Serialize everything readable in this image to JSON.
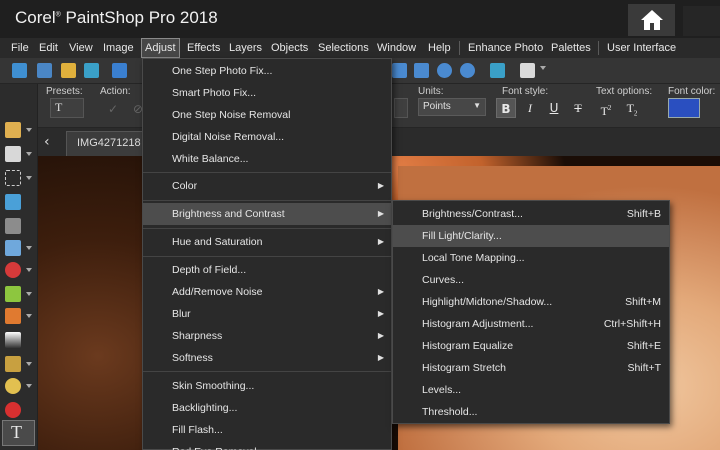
{
  "app": {
    "title": "Corel PaintShop Pro 2018",
    "title_main": "Corel",
    "title_rest": "PaintShop Pro 2018",
    "reg_mark": "®"
  },
  "menubar": [
    {
      "label": "File"
    },
    {
      "label": "Edit"
    },
    {
      "label": "View"
    },
    {
      "label": "Image"
    },
    {
      "label": "Adjust"
    },
    {
      "label": "Effects"
    },
    {
      "label": "Layers"
    },
    {
      "label": "Objects"
    },
    {
      "label": "Selections"
    },
    {
      "label": "Window"
    },
    {
      "label": "Help"
    },
    {
      "label": "Enhance Photo"
    },
    {
      "label": "Palettes"
    },
    {
      "label": "User Interface"
    }
  ],
  "options": {
    "presets_label": "Presets:",
    "action_label": "Action:",
    "units_label": "Units:",
    "units_value": "Points",
    "font_style_label": "Font style:",
    "text_options_label": "Text options:",
    "font_color_label": "Font color:",
    "font_color": "#2a4fc0"
  },
  "tab": {
    "label": "IMG4271218"
  },
  "adjust_menu": {
    "items": [
      {
        "label": "One Step Photo Fix..."
      },
      {
        "label": "Smart Photo Fix..."
      },
      {
        "label": "One Step Noise Removal"
      },
      {
        "label": "Digital Noise Removal..."
      },
      {
        "label": "White Balance..."
      },
      {
        "label": "Color"
      },
      {
        "label": "Brightness and Contrast"
      },
      {
        "label": "Hue and Saturation"
      },
      {
        "label": "Depth of Field..."
      },
      {
        "label": "Add/Remove Noise"
      },
      {
        "label": "Blur"
      },
      {
        "label": "Sharpness"
      },
      {
        "label": "Softness"
      },
      {
        "label": "Skin Smoothing..."
      },
      {
        "label": "Backlighting..."
      },
      {
        "label": "Fill Flash..."
      },
      {
        "label": "Red Eye Removal..."
      }
    ]
  },
  "brightness_menu": {
    "items": [
      {
        "label": "Brightness/Contrast...",
        "shortcut": "Shift+B"
      },
      {
        "label": "Fill Light/Clarity...",
        "shortcut": ""
      },
      {
        "label": "Local Tone Mapping...",
        "shortcut": ""
      },
      {
        "label": "Curves...",
        "shortcut": ""
      },
      {
        "label": "Highlight/Midtone/Shadow...",
        "shortcut": "Shift+M"
      },
      {
        "label": "Histogram Adjustment...",
        "shortcut": "Ctrl+Shift+H"
      },
      {
        "label": "Histogram Equalize",
        "shortcut": "Shift+E"
      },
      {
        "label": "Histogram Stretch",
        "shortcut": "Shift+T"
      },
      {
        "label": "Levels...",
        "shortcut": ""
      },
      {
        "label": "Threshold...",
        "shortcut": ""
      }
    ]
  },
  "icons": {
    "home": "home-icon",
    "submenu": "chevron-right-icon",
    "text_tool": "text-tool-icon"
  },
  "colors": {
    "accent_highlight": "#4d4d4d",
    "font_color_swatch": "#2a4fc0"
  }
}
